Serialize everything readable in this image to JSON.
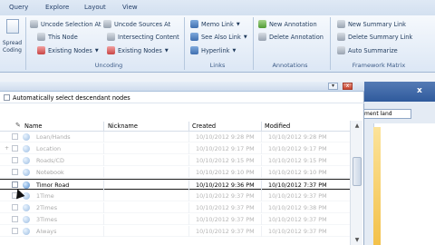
{
  "menu": {
    "tabs": [
      "Query",
      "Explore",
      "Layout",
      "View"
    ]
  },
  "ribbon": {
    "spread": {
      "label_1": "Spread",
      "label_2": "Coding"
    },
    "coding": {
      "uncode_selection": "Uncode Selection At",
      "this_node": "This Node",
      "existing_nodes_1": "Existing Nodes",
      "uncode_sources": "Uncode Sources At",
      "intersecting_content": "Intersecting Content",
      "existing_nodes_2": "Existing Nodes",
      "group_label": "Uncoding"
    },
    "links": {
      "memo_link": "Memo Link",
      "see_also_link": "See Also Link",
      "hyperlink": "Hyperlink",
      "group_label": "Links"
    },
    "annotations": {
      "new_annotation": "New Annotation",
      "delete_annotation": "Delete Annotation",
      "group_label": "Annotations"
    },
    "framework": {
      "new_summary_link": "New Summary Link",
      "delete_summary_link": "Delete Summary Link",
      "auto_summarize": "Auto Summarize",
      "group_label": "Framework Matrix"
    }
  },
  "right_pane": {
    "close": "x",
    "field_text": "ment land"
  },
  "panel": {
    "minimize": "▾",
    "close": "x",
    "auto_select_label": "Automatically select descendant nodes",
    "columns": {
      "name": "Name",
      "nickname": "Nickname",
      "created": "Created",
      "modified": "Modified"
    },
    "rows": [
      {
        "name": "Loan/Hands",
        "created": "10/10/2012 9:28 PM",
        "modified": "10/10/2012 9:28 PM",
        "expand": "",
        "style": "dim"
      },
      {
        "name": "Location",
        "created": "10/10/2012 9:17 PM",
        "modified": "10/10/2012 9:17 PM",
        "expand": "+",
        "style": "dim"
      },
      {
        "name": "Roads/CD",
        "created": "10/10/2012 9:15 PM",
        "modified": "10/10/2012 9:15 PM",
        "expand": "",
        "style": "dim"
      },
      {
        "name": "Notebook",
        "created": "10/10/2012 9:10 PM",
        "modified": "10/10/2012 9:10 PM",
        "expand": "",
        "style": "drag"
      },
      {
        "name": "Timor Road",
        "created": "10/10/2012 9:36 PM",
        "modified": "10/10/2012 7:37 PM",
        "expand": "",
        "style": "selected"
      },
      {
        "name": "1Time",
        "created": "10/10/2012 9:37 PM",
        "modified": "10/10/2012 9:37 PM",
        "expand": "",
        "style": "dim"
      },
      {
        "name": "2Times",
        "created": "10/10/2012 9:37 PM",
        "modified": "10/10/2012 9:38 PM",
        "expand": "",
        "style": "dim"
      },
      {
        "name": "3Times",
        "created": "10/10/2012 9:37 PM",
        "modified": "10/10/2012 9:37 PM",
        "expand": "",
        "style": "dim"
      },
      {
        "name": "Always",
        "created": "10/10/2012 9:37 PM",
        "modified": "10/10/2012 9:37 PM",
        "expand": "",
        "style": "dim"
      }
    ]
  }
}
